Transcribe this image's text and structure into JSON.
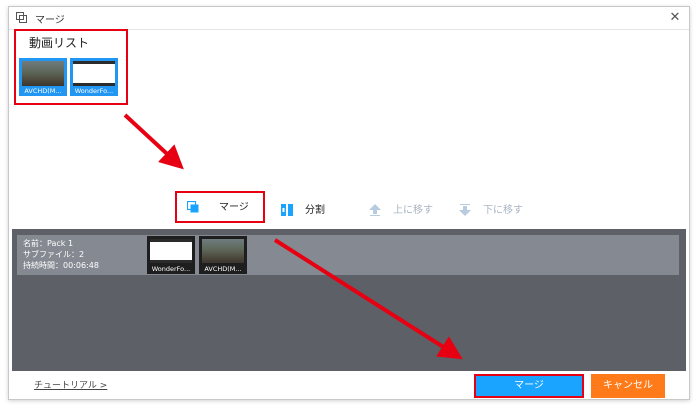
{
  "window": {
    "title": "マージ",
    "close_glyph": "✕"
  },
  "video_list": {
    "heading": "動画リスト",
    "items": [
      {
        "label": "AVCHD(M...",
        "kind": "video"
      },
      {
        "label": "WonderFo...",
        "kind": "document"
      }
    ]
  },
  "toolbar": {
    "merge": "マージ",
    "split": "分割",
    "move_up": "上に移す",
    "move_down": "下に移す"
  },
  "pack": {
    "name": "名前：Pack 1",
    "subfiles": "サブファイル：2",
    "duration": "持続時間：00:06:48",
    "thumbs": [
      {
        "label": "WonderFo...",
        "kind": "document"
      },
      {
        "label": "AVCHD(M...",
        "kind": "video"
      }
    ]
  },
  "footer": {
    "tutorial_link": "チュートリアル >",
    "merge_button": "マージ",
    "cancel_button": "キャンセル"
  },
  "colors": {
    "accent_blue": "#1aa3ff",
    "cancel_orange": "#ff7b1a",
    "highlight_red": "#e60012",
    "panel_dark": "#5d6066"
  }
}
